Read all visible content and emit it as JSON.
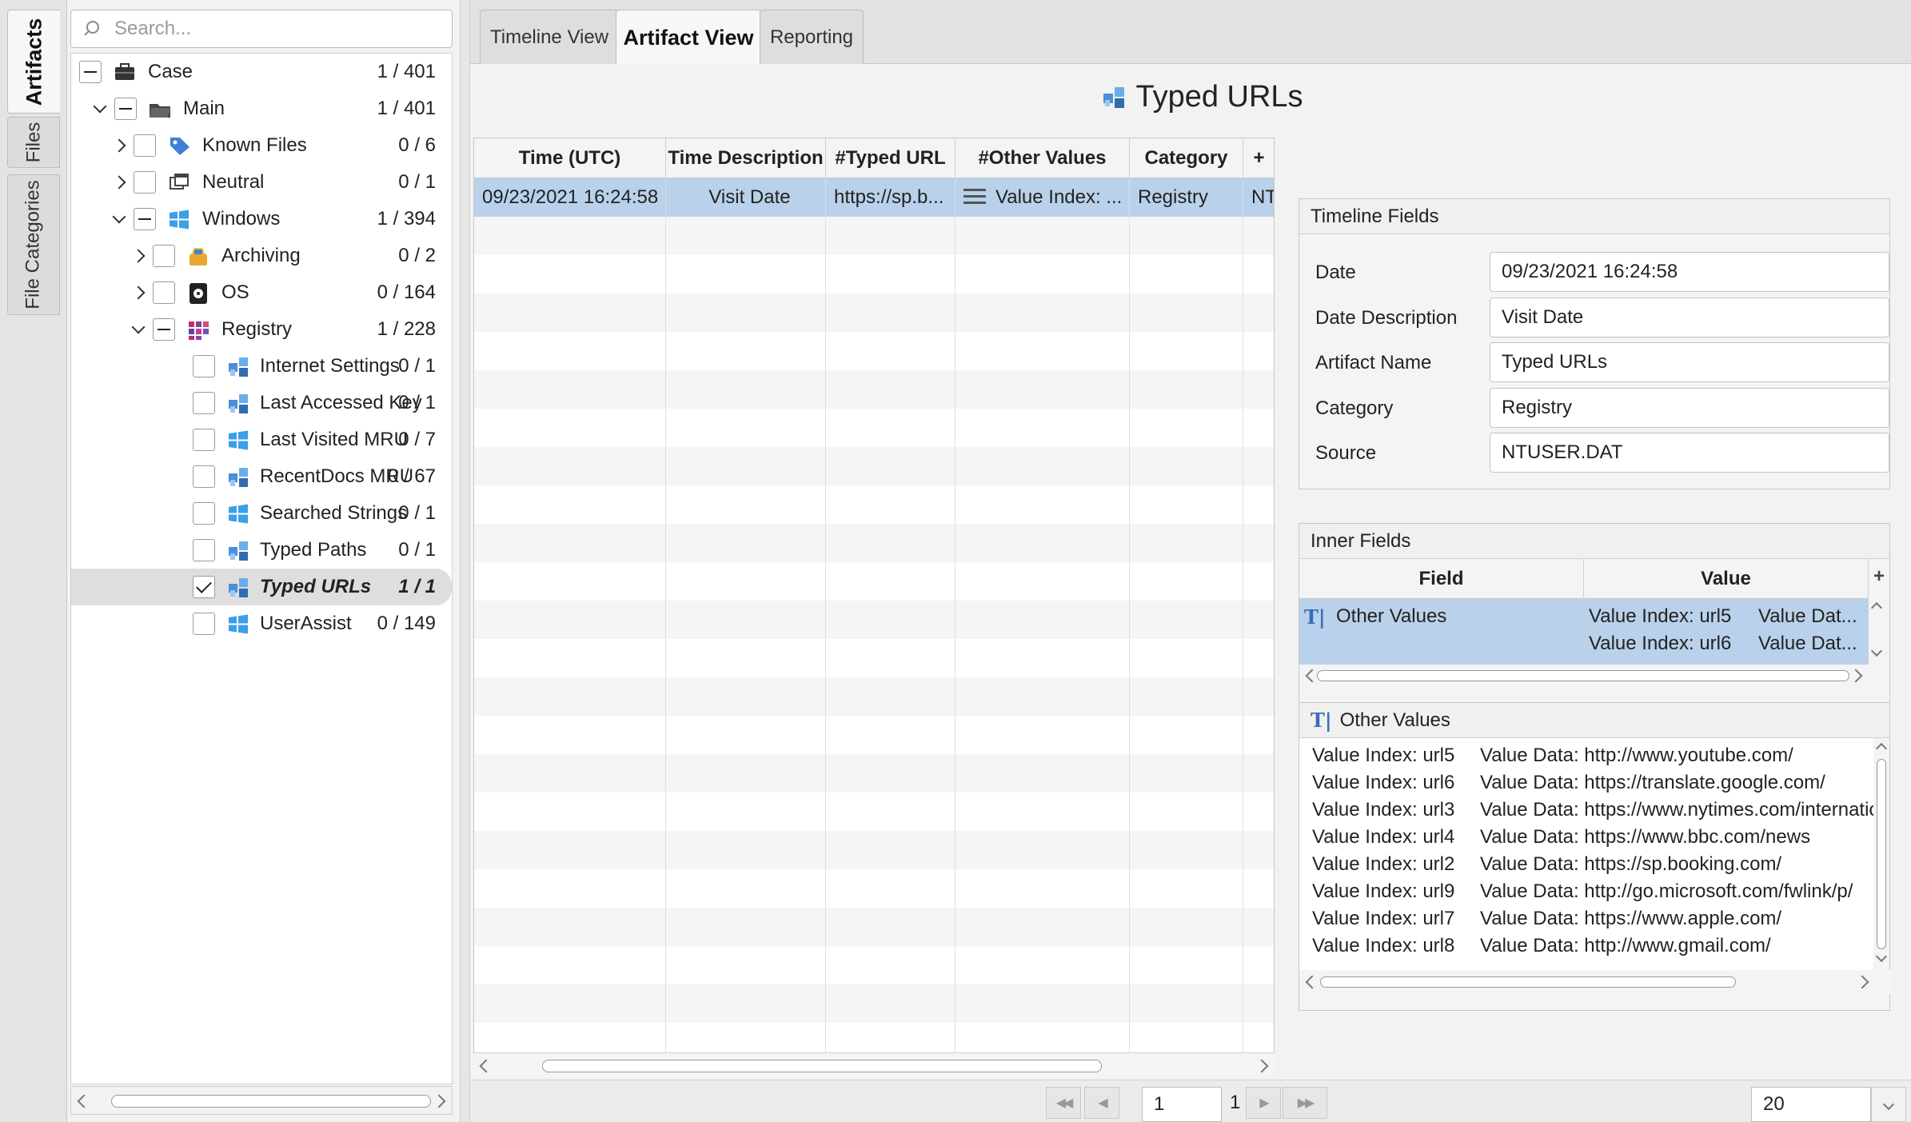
{
  "side_tabs": [
    {
      "label": "Artifacts",
      "active": true
    },
    {
      "label": "Files",
      "active": false
    },
    {
      "label": "File Categories",
      "active": false
    }
  ],
  "search": {
    "placeholder": "Search..."
  },
  "tree": [
    {
      "label": "Case",
      "count": "1 / 401",
      "icon": "briefcase-icon",
      "check": "partial",
      "expand": "none",
      "selected": false
    },
    {
      "label": "Main",
      "count": "1 / 401",
      "icon": "folder-icon",
      "check": "partial",
      "expand": "down",
      "selected": false
    },
    {
      "label": "Known Files",
      "count": "0 / 6",
      "icon": "tag-icon",
      "check": "none",
      "expand": "right",
      "selected": false
    },
    {
      "label": "Neutral",
      "count": "0 / 1",
      "icon": "windows-stack-icon",
      "check": "none",
      "expand": "right",
      "selected": false
    },
    {
      "label": "Windows",
      "count": "1 / 394",
      "icon": "windows-logo-icon",
      "check": "partial",
      "expand": "down",
      "selected": false
    },
    {
      "label": "Archiving",
      "count": "0 / 2",
      "icon": "archive-icon",
      "check": "none",
      "expand": "right",
      "selected": false
    },
    {
      "label": "OS",
      "count": "0 / 164",
      "icon": "os-icon",
      "check": "none",
      "expand": "right",
      "selected": false
    },
    {
      "label": "Registry",
      "count": "1 / 228",
      "icon": "registry-icon",
      "check": "partial",
      "expand": "down",
      "selected": false
    },
    {
      "label": "Internet Settings",
      "count": "0 / 1",
      "icon": "registry-cube-icon",
      "check": "none",
      "expand": "none",
      "selected": false
    },
    {
      "label": "Last Accessed Key",
      "count": "0 / 1",
      "icon": "registry-cube-icon",
      "check": "none",
      "expand": "none",
      "selected": false
    },
    {
      "label": "Last Visited MRU",
      "count": "0 / 7",
      "icon": "windows-logo-icon",
      "check": "none",
      "expand": "none",
      "selected": false
    },
    {
      "label": "RecentDocs MRU",
      "count": "0 / 67",
      "icon": "registry-cube-icon",
      "check": "none",
      "expand": "none",
      "selected": false
    },
    {
      "label": "Searched Strings",
      "count": "0 / 1",
      "icon": "windows-logo-icon",
      "check": "none",
      "expand": "none",
      "selected": false
    },
    {
      "label": "Typed Paths",
      "count": "0 / 1",
      "icon": "registry-cube-icon",
      "check": "none",
      "expand": "none",
      "selected": false
    },
    {
      "label": "Typed URLs",
      "count": "1 / 1",
      "icon": "registry-cube-icon",
      "check": "checked",
      "expand": "none",
      "selected": true
    },
    {
      "label": "UserAssist",
      "count": "0 / 149",
      "icon": "windows-logo-icon",
      "check": "none",
      "expand": "none",
      "selected": false
    }
  ],
  "tabs": [
    {
      "label": "Timeline View",
      "active": false
    },
    {
      "label": "Artifact View",
      "active": true
    },
    {
      "label": "Reporting",
      "active": false
    }
  ],
  "artifact_title": "Typed URLs",
  "table": {
    "columns": [
      "Time (UTC)",
      "Time Description",
      "#Typed URL",
      "#Other Values",
      "Category",
      "+"
    ],
    "rows": [
      {
        "time": "09/23/2021 16:24:58",
        "desc": "Visit Date",
        "url": "https://sp.b...",
        "other": "Value Index: ...",
        "category": "Registry",
        "extra": "NT"
      }
    ]
  },
  "pagination": {
    "page": "1",
    "total": "1",
    "page_size": "20"
  },
  "timeline_fields": {
    "title": "Timeline Fields",
    "fields": [
      {
        "label": "Date",
        "value": "09/23/2021 16:24:58"
      },
      {
        "label": "Date Description",
        "value": "Visit Date"
      },
      {
        "label": "Artifact Name",
        "value": "Typed URLs"
      },
      {
        "label": "Category",
        "value": "Registry"
      },
      {
        "label": "Source",
        "value": "NTUSER.DAT"
      }
    ]
  },
  "inner_fields": {
    "title": "Inner Fields",
    "col_field": "Field",
    "col_value": "Value",
    "plus": "+",
    "row_field": "Other Values",
    "row_lines": [
      {
        "idx": "Value Index: url5",
        "dat": "Value Dat..."
      },
      {
        "idx": "Value Index: url6",
        "dat": "Value Dat..."
      }
    ]
  },
  "other_values": {
    "title": "Other Values",
    "lines": [
      {
        "idx": "Value Index: url5",
        "dat": "Value Data: http://www.youtube.com/"
      },
      {
        "idx": "Value Index: url6",
        "dat": "Value Data: https://translate.google.com/"
      },
      {
        "idx": "Value Index: url3",
        "dat": "Value Data: https://www.nytimes.com/international/"
      },
      {
        "idx": "Value Index: url4",
        "dat": "Value Data: https://www.bbc.com/news"
      },
      {
        "idx": "Value Index: url2",
        "dat": "Value Data: https://sp.booking.com/"
      },
      {
        "idx": "Value Index: url9",
        "dat": "Value Data: http://go.microsoft.com/fwlink/p/"
      },
      {
        "idx": "Value Index: url7",
        "dat": "Value Data: https://www.apple.com/"
      },
      {
        "idx": "Value Index: url8",
        "dat": "Value Data: http://www.gmail.com/"
      }
    ]
  }
}
